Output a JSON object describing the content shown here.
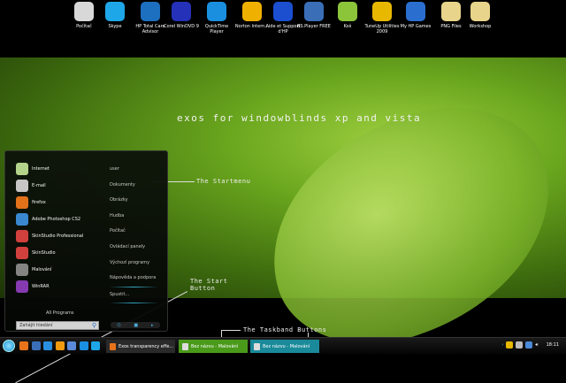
{
  "desktop_icons": [
    {
      "label": "Počítač",
      "color": "#d8d8d8"
    },
    {
      "label": "Skype",
      "color": "#1ea7e8"
    },
    {
      "label": "HP Total Care Advisor",
      "color": "#1d6fc0"
    },
    {
      "label": "Corel WinDVD 9",
      "color": "#2431b8"
    },
    {
      "label": "QuickTime Player",
      "color": "#1a8fe0"
    },
    {
      "label": "Norton Intern...",
      "color": "#f0b000"
    },
    {
      "label": "Aide et Support d'HP",
      "color": "#1b4fd0"
    },
    {
      "label": "BS.Player FREE",
      "color": "#3a6fb8"
    },
    {
      "label": "Koš",
      "color": "#8cc43a"
    },
    {
      "label": "TuneUp Utilities 2009",
      "color": "#e8b800"
    },
    {
      "label": "My HP Games",
      "color": "#2a6fd0"
    },
    {
      "label": "PNG Files",
      "color": "#e8d48a"
    },
    {
      "label": "Workshop",
      "color": "#e8d48a"
    }
  ],
  "headline": "Exos for WindowBlinds XP and Vista",
  "notes": {
    "startmenu": "The Startmenu",
    "startbutton_1": "The Start",
    "startbutton_2": "Button",
    "taskband": "The Taskband Buttons"
  },
  "start_menu": {
    "programs": [
      {
        "label": "Internet",
        "color": "#b8d890"
      },
      {
        "label": "E-mail",
        "color": "#cccccc"
      },
      {
        "label": "firefox",
        "color": "#e8731a"
      },
      {
        "label": "Adobe Photoshop CS2",
        "color": "#3a8ad8"
      },
      {
        "label": "SkinStudio Professional",
        "color": "#d84040"
      },
      {
        "label": "SkinStudio",
        "color": "#d84040"
      },
      {
        "label": "Malování",
        "color": "#888888"
      },
      {
        "label": "WinRAR",
        "color": "#8a3ab8"
      }
    ],
    "places": [
      "user",
      "Dokumenty",
      "Obrázky",
      "Hudba",
      "Počítač",
      "Ovládací panely",
      "Výchozí programy",
      "Nápověda a podpora"
    ],
    "run": "Spustit...",
    "all_programs": "All Programs",
    "search_placeholder": "Zahájit hledání",
    "power_icons": [
      "power-icon",
      "lock-icon",
      "arrow-icon"
    ]
  },
  "taskbar": {
    "quick_launch": [
      {
        "name": "firefox",
        "color": "#e8731a"
      },
      {
        "name": "desktop",
        "color": "#3a6fb8"
      },
      {
        "name": "ie",
        "color": "#2a8fe0"
      },
      {
        "name": "media",
        "color": "#f09a10"
      },
      {
        "name": "explorer",
        "color": "#5a8ad8"
      },
      {
        "name": "quicktime",
        "color": "#1a8fe0"
      },
      {
        "name": "skype",
        "color": "#1ea7e8"
      }
    ],
    "tasks": [
      {
        "label": "Exos transparency effe...",
        "state": "normal"
      },
      {
        "label": "Bez názvu - Malování",
        "state": "green"
      },
      {
        "label": "Bez názvu - Malování",
        "state": "active"
      }
    ],
    "clock": "18:11",
    "colors": {
      "normal": "#2a2a2a",
      "green": "#4a9a1a",
      "active": "#1a8a9a"
    }
  }
}
